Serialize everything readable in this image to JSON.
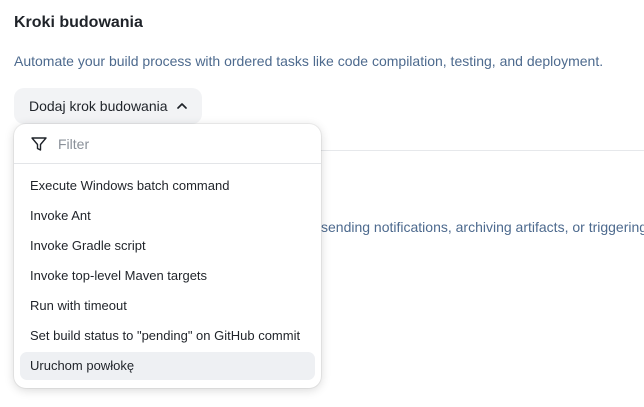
{
  "section": {
    "title": "Kroki budowania",
    "description": "Automate your build process with ordered tasks like code compilation, testing, and deployment."
  },
  "background": {
    "description_fragment": "sending notifications, archiving artifacts, or triggering"
  },
  "add_step_button": {
    "label": "Dodaj krok budowania",
    "icon": "chevron-up-icon"
  },
  "dropdown": {
    "filter_placeholder": "Filter",
    "filter_value": "",
    "filter_icon": "filter-icon",
    "items": [
      {
        "label": "Execute Windows batch command"
      },
      {
        "label": "Invoke Ant"
      },
      {
        "label": "Invoke Gradle script"
      },
      {
        "label": "Invoke top-level Maven targets"
      },
      {
        "label": "Run with timeout"
      },
      {
        "label": "Set build status to \"pending\" on GitHub commit"
      },
      {
        "label": "Uruchom powłokę",
        "highlighted": true
      }
    ]
  },
  "colors": {
    "description_text": "#4d6a8e",
    "button_background": "#f2f3f5",
    "highlight_background": "#eef0f3"
  }
}
